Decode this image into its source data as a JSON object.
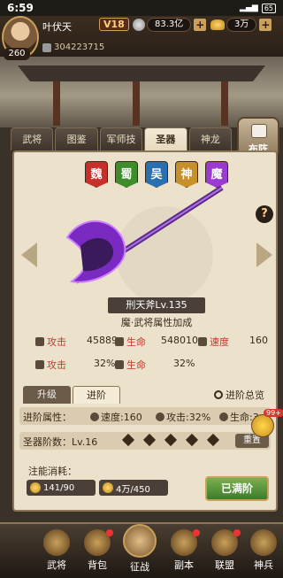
{
  "status": {
    "time": "6:59",
    "battery": "65"
  },
  "player": {
    "name": "叶伏天",
    "level": "260",
    "vip": "V18",
    "id": "304223715"
  },
  "currency": {
    "silver": "83.3亿",
    "ingot": "3万"
  },
  "tabs": [
    {
      "label": "武将",
      "active": false
    },
    {
      "label": "图鉴",
      "active": false
    },
    {
      "label": "军师技",
      "active": false
    },
    {
      "label": "圣器",
      "active": true
    },
    {
      "label": "神龙",
      "active": false
    }
  ],
  "formation_label": "布阵",
  "factions": [
    {
      "label": "魏",
      "key": "wei"
    },
    {
      "label": "蜀",
      "key": "shu"
    },
    {
      "label": "吴",
      "key": "wu"
    },
    {
      "label": "神",
      "key": "shen"
    },
    {
      "label": "魔",
      "key": "mo"
    }
  ],
  "help_label": "?",
  "weapon": {
    "name": "刑天斧Lv.135",
    "desc": "魔·武将属性加成"
  },
  "stats": {
    "attack_label": "攻击",
    "attack_value": "45889",
    "hp_label": "生命",
    "hp_value": "548010",
    "speed_label": "速度",
    "speed_value": "160",
    "attack_pct_label": "攻击",
    "attack_pct_value": "32%",
    "hp_pct_label": "生命",
    "hp_pct_value": "32%"
  },
  "lower_tabs": [
    {
      "label": "升级",
      "active": false
    },
    {
      "label": "进阶",
      "active": true
    }
  ],
  "overview_label": "进阶总览",
  "advance": {
    "attr_title": "进阶属性：",
    "speed_chip": "速度:160",
    "attack_chip": "攻击:32%",
    "hp_chip": "生命:3",
    "stage_title": "圣器阶数：Lv.16",
    "reset_label": "重置",
    "chat_badge": "99+"
  },
  "cost": {
    "title": "注能消耗：",
    "item1": "141/90",
    "item2": "4万/450"
  },
  "maxed_label": "已满阶",
  "nav": [
    {
      "label": "武将"
    },
    {
      "label": "背包"
    },
    {
      "label": "征战"
    },
    {
      "label": "副本"
    },
    {
      "label": "联盟"
    },
    {
      "label": "神兵"
    }
  ]
}
